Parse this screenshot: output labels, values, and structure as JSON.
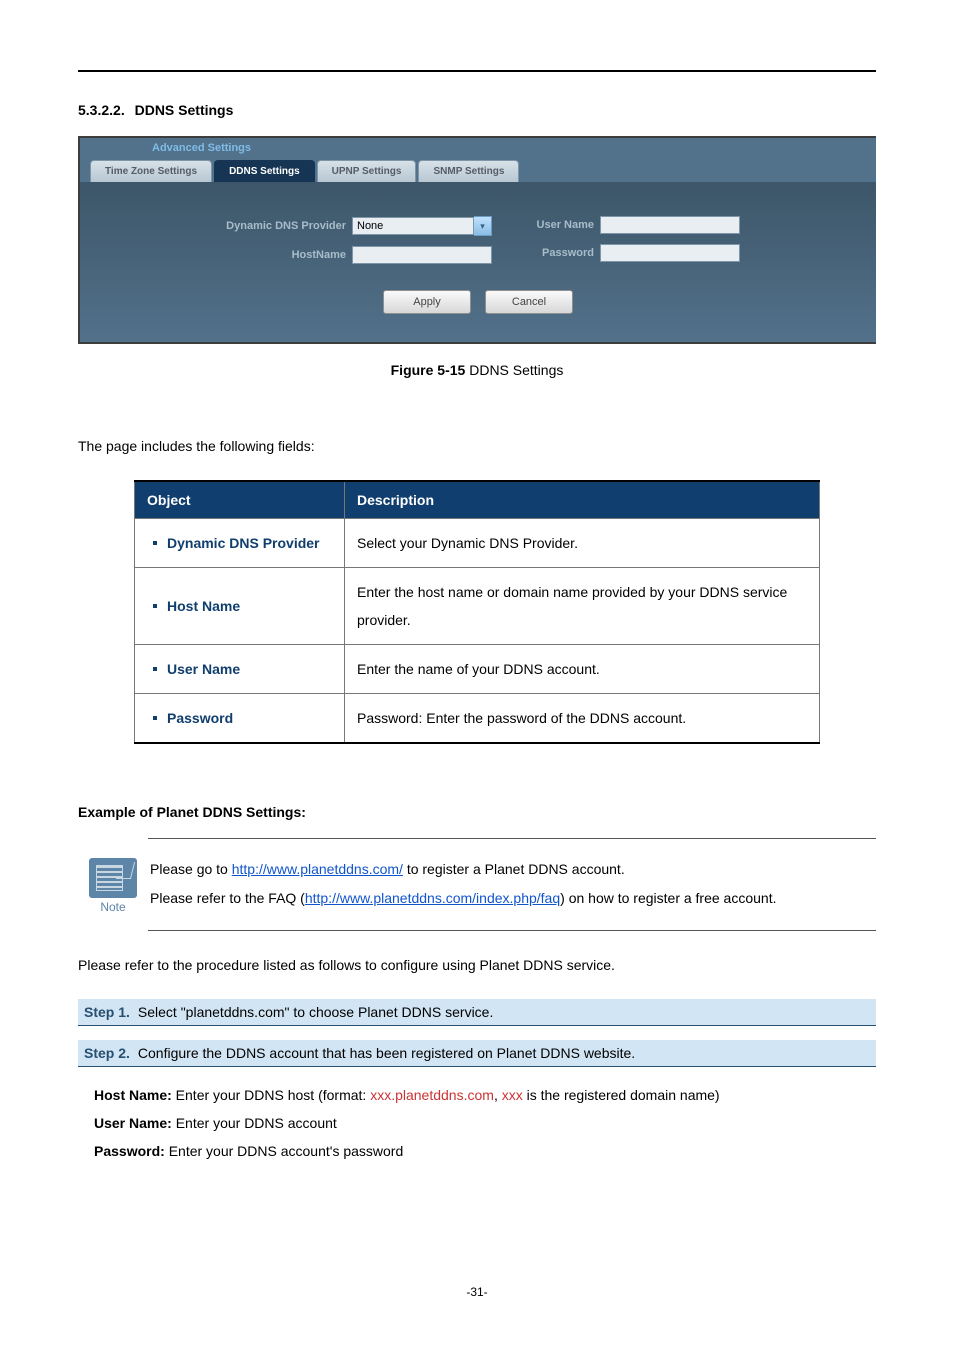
{
  "heading": {
    "number": "5.3.2.2.",
    "title": "DDNS Settings"
  },
  "screenshot": {
    "breadcrumb": "Advanced Settings",
    "tabs": [
      {
        "label": "Time Zone Settings",
        "active": false
      },
      {
        "label": "DDNS Settings",
        "active": true
      },
      {
        "label": "UPNP Settings",
        "active": false
      },
      {
        "label": "SNMP Settings",
        "active": false
      }
    ],
    "fields": {
      "provider_label": "Dynamic DNS Provider",
      "provider_value": "None",
      "hostname_label": "HostName",
      "hostname_value": "",
      "username_label": "User Name",
      "username_value": "",
      "password_label": "Password",
      "password_value": ""
    },
    "buttons": {
      "apply": "Apply",
      "cancel": "Cancel"
    }
  },
  "figure_caption": {
    "label": "Figure 5-15",
    "text": " DDNS Settings"
  },
  "intro_para": "The page includes the following fields:",
  "table": {
    "head": {
      "object": "Object",
      "description": "Description"
    },
    "rows": [
      {
        "object": "Dynamic DNS Provider",
        "description": "Select your Dynamic DNS Provider."
      },
      {
        "object": "Host Name",
        "description": "Enter the host name or domain name provided by your DDNS service provider."
      },
      {
        "object": "User Name",
        "description": "Enter the name of your DDNS account."
      },
      {
        "object": "Password",
        "description": "Password: Enter the password of the DDNS account."
      }
    ]
  },
  "example_heading": "Example of Planet DDNS Settings:",
  "note": {
    "label": "Note",
    "line1_pre": "Please go to ",
    "line1_link": "http://www.planetddns.com/",
    "line1_post": " to register a Planet DDNS account.",
    "line2_pre": "Please refer to the FAQ (",
    "line2_link": "http://www.planetddns.com/index.php/faq",
    "line2_post": ") on how to register a free account."
  },
  "procedure_para": "Please refer to the procedure listed as follows to configure using Planet DDNS service.",
  "steps": [
    {
      "label": "Step 1.",
      "text": "Select \"planetddns.com\" to choose Planet DDNS service."
    },
    {
      "label": "Step 2.",
      "text": "Configure the DDNS account that has been registered on Planet DDNS website."
    }
  ],
  "step2_details": {
    "host_label": "Host Name:",
    "host_pre": " Enter your DDNS host (format: ",
    "host_hl1": "xxx.planetddns.com",
    "host_mid": ", ",
    "host_hl2": "xxx",
    "host_post": " is the registered domain name)",
    "user_label": "User Name:",
    "user_text": " Enter your DDNS account",
    "pass_label": "Password:",
    "pass_text": " Enter your DDNS account's password"
  },
  "page_number": "-31-"
}
